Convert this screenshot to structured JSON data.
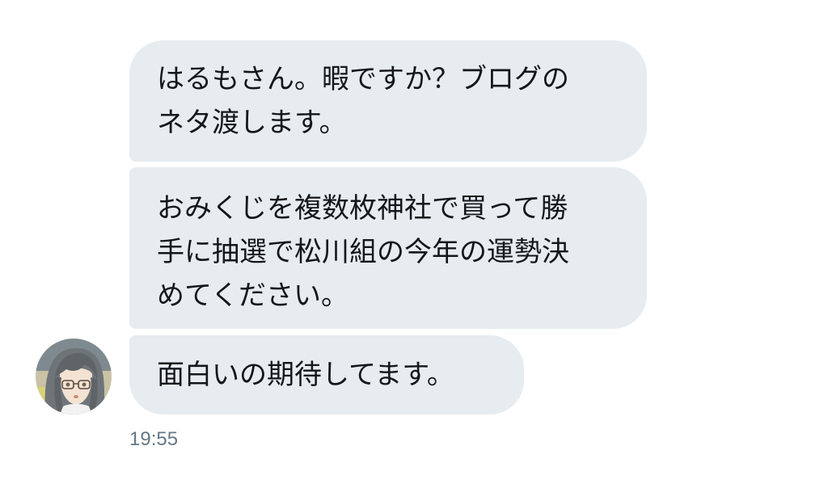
{
  "conversation": {
    "messages": [
      {
        "lines": [
          "はるもさん。暇ですか？ブログの",
          "ネタ渡します。"
        ]
      },
      {
        "lines": [
          "おみくじを複数枚神社で買って勝",
          "手に抽選で松川組の今年の運勢決",
          "めてください。"
        ]
      },
      {
        "lines": [
          "面白いの期待してます。"
        ]
      }
    ],
    "timestamp": "19:55",
    "sender_avatar_icon": "anime-girl-glasses-avatar"
  },
  "colors": {
    "bubble_background": "#e6ecf0",
    "message_text": "#14171a",
    "timestamp_text": "#657786"
  }
}
